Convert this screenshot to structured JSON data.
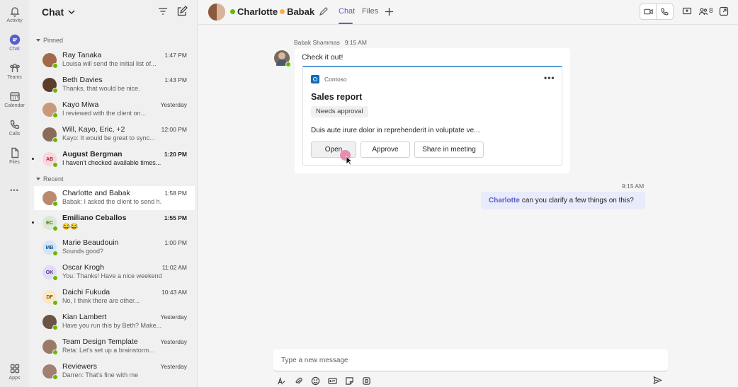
{
  "rail": {
    "items": [
      {
        "label": "Activity",
        "icon": "bell-icon"
      },
      {
        "label": "Chat",
        "icon": "chat-icon"
      },
      {
        "label": "Teams",
        "icon": "teams-icon"
      },
      {
        "label": "Calendar",
        "icon": "calendar-icon"
      },
      {
        "label": "Calls",
        "icon": "phone-icon"
      },
      {
        "label": "Files",
        "icon": "file-icon"
      },
      {
        "label": "",
        "icon": "more-icon"
      },
      {
        "label": "Apps",
        "icon": "apps-icon"
      }
    ],
    "more_glyph": "•••"
  },
  "chatlist": {
    "title": "Chat",
    "pinned_label": "Pinned",
    "recent_label": "Recent",
    "pinned": [
      {
        "name": "Ray Tanaka",
        "time": "1:47 PM",
        "preview": "Louisa will send the initial list of...",
        "avatar_color": "#a06a4a",
        "initials": "",
        "bold": false
      },
      {
        "name": "Beth Davies",
        "time": "1:43 PM",
        "preview": "Thanks, that would be nice.",
        "avatar_color": "#5a3e2b",
        "initials": "",
        "bold": false
      },
      {
        "name": "Kayo Miwa",
        "time": "Yesterday",
        "preview": "I reviewed with the client on...",
        "avatar_color": "#c89a7a",
        "initials": "",
        "bold": false
      },
      {
        "name": "Will, Kayo, Eric, +2",
        "time": "12:00 PM",
        "preview": "Kayo: It would be great to sync...",
        "avatar_color": "#8a6b5a",
        "initials": "",
        "bold": false
      },
      {
        "name": "August Bergman",
        "time": "1:20 PM",
        "preview": "I haven't checked available times...",
        "avatar_color": "#f8d6de",
        "initials": "AB",
        "initials_color": "#a4262c",
        "bold": true
      }
    ],
    "recent": [
      {
        "name": "Charlotte and Babak",
        "time": "1:58 PM",
        "preview": "Babak: I asked the client to send h...",
        "avatar_color": "#b98a6e",
        "initials": "",
        "bold": false,
        "selected": true
      },
      {
        "name": "Emiliano Ceballos",
        "time": "1:55 PM",
        "preview": "😂😂",
        "avatar_color": "#dbe8d4",
        "initials": "EC",
        "initials_color": "#437406",
        "bold": true
      },
      {
        "name": "Marie Beaudouin",
        "time": "1:00 PM",
        "preview": "Sounds good?",
        "avatar_color": "#d6e4f7",
        "initials": "MB",
        "initials_color": "#0f548c",
        "bold": false
      },
      {
        "name": "Oscar Krogh",
        "time": "11:02 AM",
        "preview": "You: Thanks! Have a nice weekend",
        "avatar_color": "#e1dcf5",
        "initials": "OK",
        "initials_color": "#5c2e91",
        "bold": false
      },
      {
        "name": "Daichi Fukuda",
        "time": "10:43 AM",
        "preview": "No, I think there are other...",
        "avatar_color": "#fbe7c6",
        "initials": "DF",
        "initials_color": "#8a5300",
        "bold": false
      },
      {
        "name": "Kian Lambert",
        "time": "Yesterday",
        "preview": "Have you run this by Beth? Make...",
        "avatar_color": "#6b5444",
        "initials": "",
        "bold": false
      },
      {
        "name": "Team Design Template",
        "time": "Yesterday",
        "preview": "Reta: Let's set up a brainstorm...",
        "avatar_color": "#9a7a66",
        "initials": "",
        "bold": false
      },
      {
        "name": "Reviewers",
        "time": "Yesterday",
        "preview": "Darren: That's fine with me",
        "avatar_color": "#a08070",
        "initials": "",
        "bold": false
      }
    ]
  },
  "header": {
    "name1": "Charlotte",
    "name2": "Babak",
    "tabs": [
      "Chat",
      "Files"
    ],
    "people_count": "8"
  },
  "messages": {
    "incoming": {
      "sender": "Babak Shammas",
      "time": "9:15 AM",
      "text": "Check it out!",
      "card": {
        "app": "Contoso",
        "more": "•••",
        "title": "Sales report",
        "badge": "Needs approval",
        "body": "Duis aute irure dolor in reprehenderit in voluptate ve...",
        "buttons": [
          "Open",
          "Approve",
          "Share in meeting"
        ]
      }
    },
    "outgoing": {
      "time": "9:15 AM",
      "mention": "Charlotte",
      "text": "can you clarify a few things on this?"
    }
  },
  "compose": {
    "placeholder": "Type a new message"
  },
  "colors": {
    "accent": "#5b5fc7",
    "presence_available": "#6bb700",
    "presence_away": "#ffaa44",
    "card_accent": "#5b9bd5",
    "outgoing_bubble": "#e8ebfa"
  }
}
